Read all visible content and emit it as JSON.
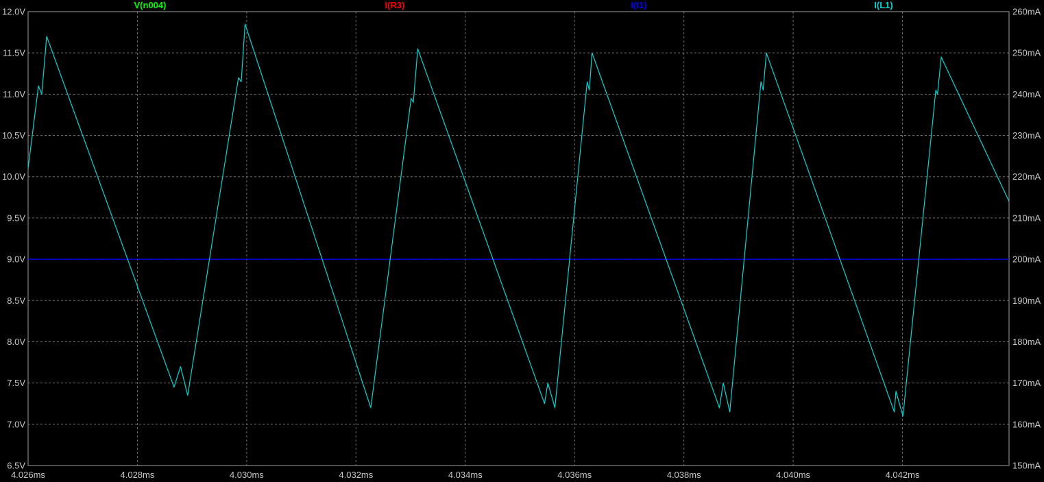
{
  "chart_data": {
    "type": "line",
    "title": "",
    "x_axis": {
      "unit": "ms",
      "min": 4.026,
      "max": 4.04395,
      "ticks": [
        4.026,
        4.028,
        4.03,
        4.032,
        4.034,
        4.036,
        4.038,
        4.04,
        4.042
      ],
      "tick_labels": [
        "4.026ms",
        "4.028ms",
        "4.030ms",
        "4.032ms",
        "4.034ms",
        "4.036ms",
        "4.038ms",
        "4.040ms",
        "4.042ms"
      ]
    },
    "y_left": {
      "unit": "V",
      "min": 6.5,
      "max": 12.0,
      "ticks": [
        6.5,
        7.0,
        7.5,
        8.0,
        8.5,
        9.0,
        9.5,
        10.0,
        10.5,
        11.0,
        11.5,
        12.0
      ],
      "tick_labels": [
        "6.5V",
        "7.0V",
        "7.5V",
        "8.0V",
        "8.5V",
        "9.0V",
        "9.5V",
        "10.0V",
        "10.5V",
        "11.0V",
        "11.5V",
        "12.0V"
      ]
    },
    "y_right": {
      "unit": "mA",
      "min": 150,
      "max": 260,
      "ticks": [
        150,
        160,
        170,
        180,
        190,
        200,
        210,
        220,
        230,
        240,
        250,
        260
      ],
      "tick_labels": [
        "150mA",
        "160mA",
        "170mA",
        "180mA",
        "190mA",
        "200mA",
        "210mA",
        "220mA",
        "230mA",
        "240mA",
        "250mA",
        "260mA"
      ]
    },
    "grid": true,
    "legend_position": "top",
    "legend": [
      {
        "label": "V(n004)",
        "color": "#00ff00"
      },
      {
        "label": "I(R3)",
        "color": "#ff0000"
      },
      {
        "label": "I(I1)",
        "color": "#0000ff"
      },
      {
        "label": "I(L1)",
        "color": "#00d8d8"
      }
    ],
    "series": [
      {
        "name": "I(I1)",
        "color": "#0000ff",
        "axis": "right",
        "points": [
          [
            4.026,
            200.0
          ],
          [
            4.04395,
            200.0
          ]
        ]
      },
      {
        "name": "I(L1)",
        "color": "#00d8d8",
        "axis": "right",
        "points": [
          [
            4.026,
            222.0
          ],
          [
            4.02619,
            242.0
          ],
          [
            4.02625,
            240.0
          ],
          [
            4.02634,
            254.0
          ],
          [
            4.02867,
            169.0
          ],
          [
            4.02879,
            174.0
          ],
          [
            4.02892,
            167.0
          ],
          [
            4.02985,
            244.0
          ],
          [
            4.0299,
            243.0
          ],
          [
            4.02997,
            257.0
          ],
          [
            4.03227,
            164.0
          ],
          [
            4.03301,
            239.0
          ],
          [
            4.03305,
            238.0
          ],
          [
            4.03313,
            251.0
          ],
          [
            4.03545,
            165.0
          ],
          [
            4.03551,
            170.0
          ],
          [
            4.03564,
            164.0
          ],
          [
            4.03623,
            243.0
          ],
          [
            4.03627,
            241.0
          ],
          [
            4.03632,
            250.0
          ],
          [
            4.03865,
            164.0
          ],
          [
            4.03872,
            170.0
          ],
          [
            4.03884,
            163.0
          ],
          [
            4.03941,
            243.0
          ],
          [
            4.03945,
            241.0
          ],
          [
            4.03951,
            250.0
          ],
          [
            4.04185,
            163.0
          ],
          [
            4.04188,
            168.0
          ],
          [
            4.04201,
            162.0
          ],
          [
            4.04261,
            241.0
          ],
          [
            4.04264,
            240.0
          ],
          [
            4.04271,
            249.0
          ],
          [
            4.04395,
            214.0
          ]
        ]
      }
    ]
  }
}
